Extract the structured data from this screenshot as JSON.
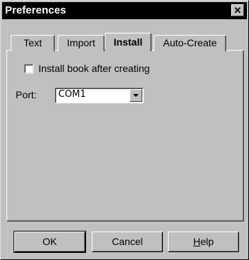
{
  "window": {
    "title": "Preferences",
    "close_glyph": "✕",
    "close_icon": "close-icon"
  },
  "tabs": [
    {
      "label": "Text"
    },
    {
      "label": "Import"
    },
    {
      "label": "Install",
      "active": true
    },
    {
      "label": "Auto-Create"
    }
  ],
  "install": {
    "checkbox_label": "Install book after creating",
    "checkbox_checked": false,
    "port_label": "Port:",
    "port_value": "COM1",
    "dropdown_icon": "chevron-down-icon"
  },
  "buttons": {
    "ok": "OK",
    "cancel": "Cancel",
    "help_mnemonic": "H",
    "help_rest": "elp"
  }
}
